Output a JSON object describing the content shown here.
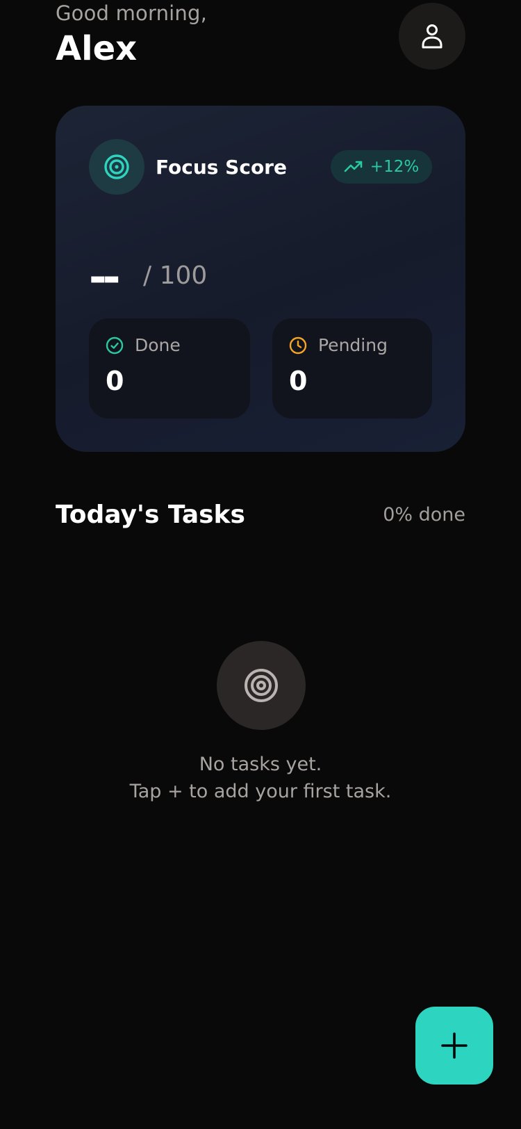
{
  "header": {
    "greeting": "Good morning,",
    "user_name": "Alex",
    "avatar_icon": "user-icon"
  },
  "focus_card": {
    "icon": "target-icon",
    "title": "Focus Score",
    "trend": {
      "icon": "trending-up-icon",
      "label": "+12%",
      "color": "#2bc9a0"
    },
    "score_value": "--",
    "score_max": "/ 100",
    "stats": {
      "done": {
        "icon": "check-circle-icon",
        "label": "Done",
        "value": "0",
        "color": "#2bc9a0"
      },
      "pending": {
        "icon": "clock-icon",
        "label": "Pending",
        "value": "0",
        "color": "#f5a524"
      }
    }
  },
  "tasks": {
    "title": "Today's Tasks",
    "progress_label": "0% done",
    "empty_state": {
      "icon": "target-icon",
      "line1": "No tasks yet.",
      "line2": "Tap + to add your first task."
    }
  },
  "fab": {
    "icon": "plus-icon",
    "color": "#2dd4bf"
  },
  "colors": {
    "background": "#0a0909",
    "accent": "#2dd4bf",
    "card": "#1a2033"
  }
}
